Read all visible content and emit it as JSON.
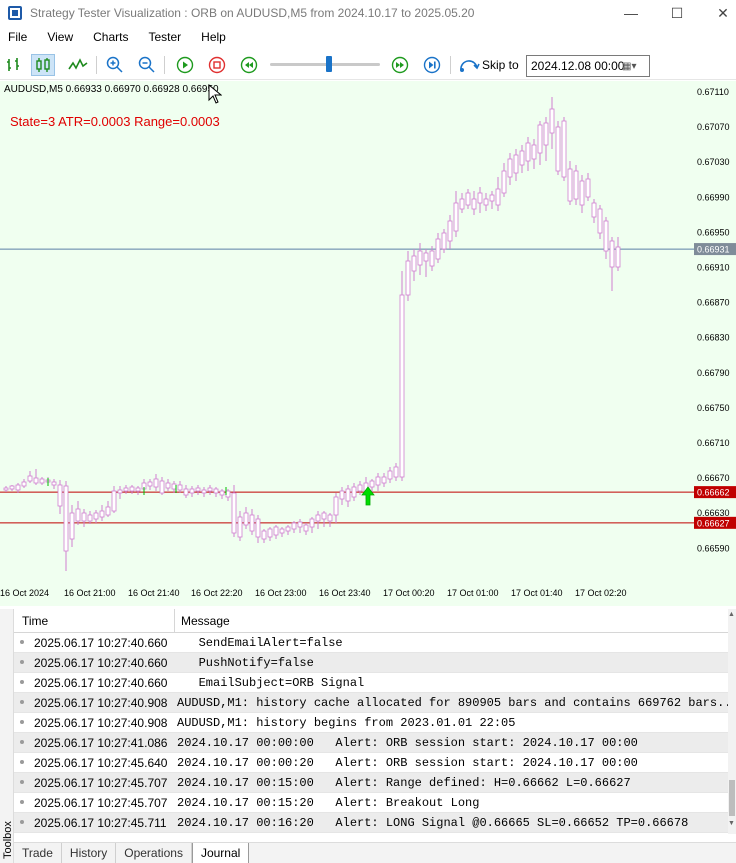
{
  "window": {
    "title": "Strategy Tester Visualization : ORB on AUDUSD,M5 from 2024.10.17 to 2025.05.20",
    "minimize": "—",
    "maximize": "☐",
    "close": "✕"
  },
  "menu": [
    "File",
    "View",
    "Charts",
    "Tester",
    "Help"
  ],
  "toolbar": {
    "skip_label": "Skip to",
    "skip_value": "2024.12.08 00:00",
    "calendar_glyph": "▦▾"
  },
  "chart": {
    "symbol_line": "AUDUSD,M5  0.66933 0.66970 0.66928 0.66950",
    "state_line": "State=3 ATR=0.0003 Range=0.0003",
    "price_labels": [
      "0.67110",
      "0.67070",
      "0.67030",
      "0.66990",
      "0.66950",
      "0.66910",
      "0.66870",
      "0.66830",
      "0.66790",
      "0.66750",
      "0.66710",
      "0.66670",
      "0.66630",
      "0.66590"
    ],
    "time_labels": [
      "16 Oct 2024",
      "16 Oct 21:00",
      "16 Oct 21:40",
      "16 Oct 22:20",
      "16 Oct 23:00",
      "16 Oct 23:40",
      "17 Oct 00:20",
      "17 Oct 01:00",
      "17 Oct 01:40",
      "17 Oct 02:20"
    ],
    "current_price_tag": "0.66931",
    "range_high_tag": "0.66662",
    "range_low_tag": "0.66627",
    "colors": {
      "background": "#f0fff0",
      "bull": "#ffffff",
      "bear": "#000000",
      "level": "#c00000",
      "current": "#5b7fa6",
      "arrow": "#00dd00"
    }
  },
  "journal": {
    "columns": {
      "time": "Time",
      "message": "Message"
    },
    "rows": [
      {
        "time": "2025.06.17 10:27:40.660",
        "message": "   SendEmailAlert=false"
      },
      {
        "time": "2025.06.17 10:27:40.660",
        "message": "   PushNotify=false"
      },
      {
        "time": "2025.06.17 10:27:40.660",
        "message": "   EmailSubject=ORB Signal"
      },
      {
        "time": "2025.06.17 10:27:40.908",
        "message": "AUDUSD,M1: history cache allocated for 890905 bars and contains 669762 bars..."
      },
      {
        "time": "2025.06.17 10:27:40.908",
        "message": "AUDUSD,M1: history begins from 2023.01.01 22:05"
      },
      {
        "time": "2025.06.17 10:27:41.086",
        "message": "2024.10.17 00:00:00   Alert: ORB session start: 2024.10.17 00:00"
      },
      {
        "time": "2025.06.17 10:27:45.640",
        "message": "2024.10.17 00:00:20   Alert: ORB session start: 2024.10.17 00:00"
      },
      {
        "time": "2025.06.17 10:27:45.707",
        "message": "2024.10.17 00:15:00   Alert: Range defined: H=0.66662 L=0.66627"
      },
      {
        "time": "2025.06.17 10:27:45.707",
        "message": "2024.10.17 00:15:20   Alert: Breakout Long"
      },
      {
        "time": "2025.06.17 10:27:45.711",
        "message": "2024.10.17 00:16:20   Alert: LONG Signal @0.66665 SL=0.66652 TP=0.66678"
      }
    ]
  },
  "toolbox_label": "Toolbox",
  "tabs": [
    "Trade",
    "History",
    "Operations",
    "Journal"
  ]
}
